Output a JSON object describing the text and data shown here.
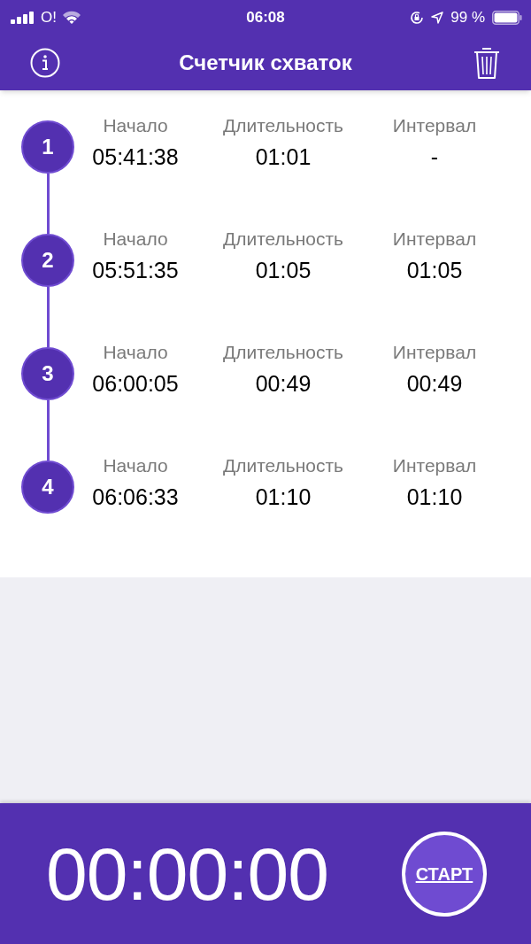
{
  "status_bar": {
    "carrier": "O!",
    "time": "06:08",
    "battery": "99 %"
  },
  "header": {
    "title": "Счетчик схваток"
  },
  "contractions": [
    {
      "number": "1",
      "start_label": "Начало",
      "start": "05:41:38",
      "duration_label": "Длительность",
      "duration": "01:01",
      "interval_label": "Интервал",
      "interval": "-"
    },
    {
      "number": "2",
      "start_label": "Начало",
      "start": "05:51:35",
      "duration_label": "Длительность",
      "duration": "01:05",
      "interval_label": "Интервал",
      "interval": "01:05"
    },
    {
      "number": "3",
      "start_label": "Начало",
      "start": "06:00:05",
      "duration_label": "Длительность",
      "duration": "00:49",
      "interval_label": "Интервал",
      "interval": "00:49"
    },
    {
      "number": "4",
      "start_label": "Начало",
      "start": "06:06:33",
      "duration_label": "Длительность",
      "duration": "01:10",
      "interval_label": "Интервал",
      "interval": "01:10"
    }
  ],
  "timer": {
    "value": "00:00:00",
    "button": "СТАРТ"
  }
}
